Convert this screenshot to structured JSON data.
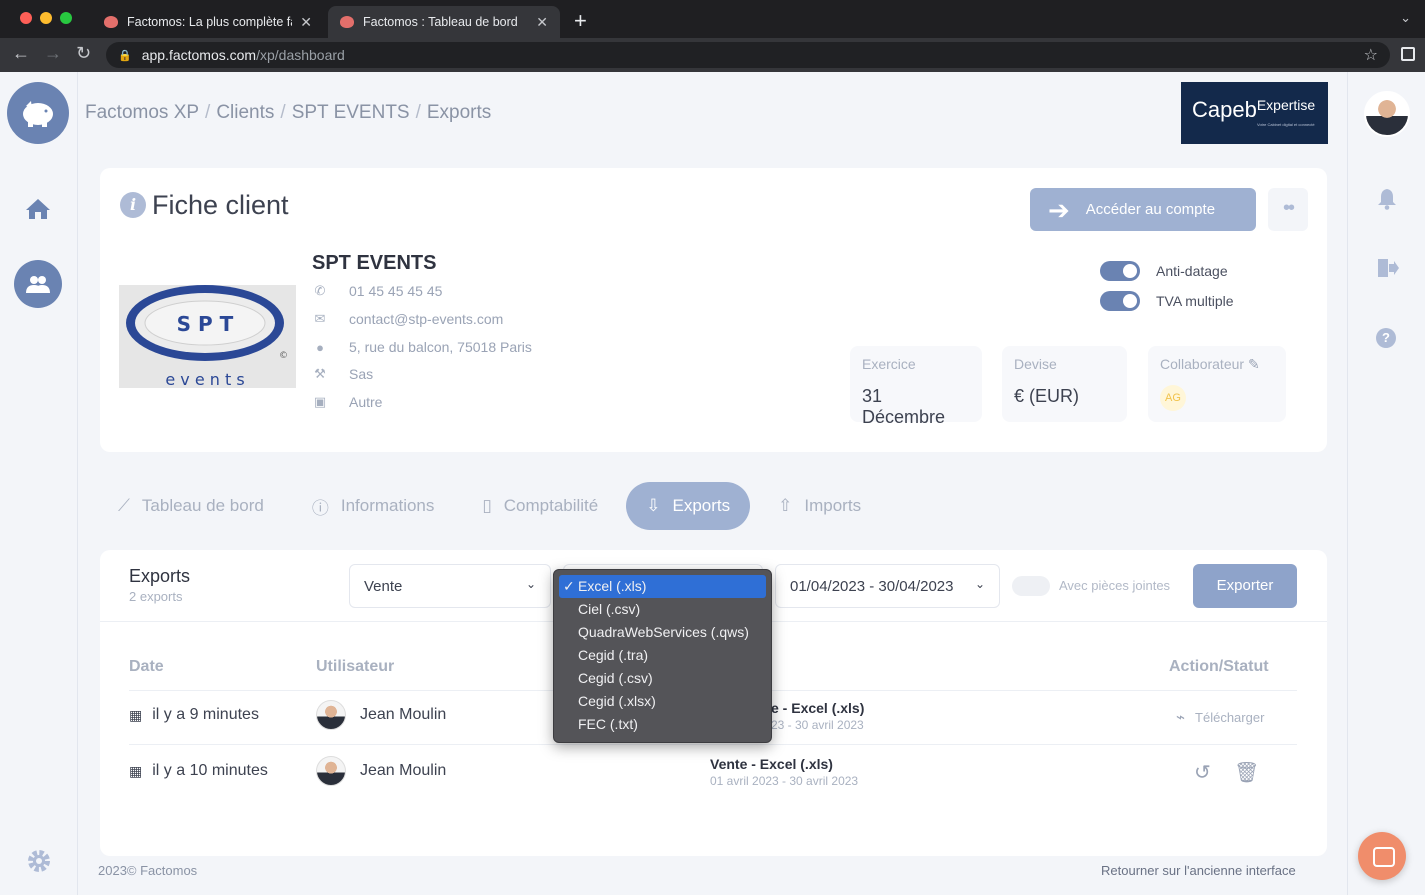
{
  "browser": {
    "tabs": [
      {
        "title": "Factomos: La plus complète fa",
        "active": false
      },
      {
        "title": "Factomos : Tableau de bord",
        "active": true
      }
    ],
    "url_host": "app.factomos.com",
    "url_path": "/xp/dashboard"
  },
  "breadcrumb": [
    "Factomos XP",
    "Clients",
    "SPT EVENTS",
    "Exports"
  ],
  "brand": {
    "name": "Capeb",
    "suffix": "Expertise",
    "tagline": "Votre Cabinet digital et connecté"
  },
  "fiche": {
    "title": "Fiche client",
    "access_button": "Accéder au compte",
    "client": {
      "name": "SPT EVENTS",
      "logo_letters_top": "S P T",
      "logo_letters_bottom": "e v e n t s",
      "phone": "01 45 45 45 45",
      "email": "contact@stp-events.com",
      "address": "5, rue du balcon, 75018 Paris",
      "legal_form": "Sas",
      "activity": "Autre"
    },
    "toggles": [
      {
        "label": "Anti-datage",
        "on": true
      },
      {
        "label": "TVA multiple",
        "on": true
      }
    ],
    "stats": {
      "exercice_label": "Exercice",
      "exercice_value": "31 Décembre",
      "devise_label": "Devise",
      "devise_value": "€ (EUR)",
      "collaborateur_label": "Collaborateur",
      "collaborateur_value": "AG"
    }
  },
  "tabs": [
    {
      "label": "Tableau de bord",
      "icon": "chart-line-icon",
      "active": false
    },
    {
      "label": "Informations",
      "icon": "info-icon",
      "active": false
    },
    {
      "label": "Comptabilité",
      "icon": "clipboard-icon",
      "active": false
    },
    {
      "label": "Exports",
      "icon": "export-icon",
      "active": true
    },
    {
      "label": "Imports",
      "icon": "import-icon",
      "active": false
    }
  ],
  "exports": {
    "title": "Exports",
    "count": "2 exports",
    "type_select": "Vente",
    "period_select": "01/04/2023 - 30/04/2023",
    "attachments_label": "Avec pièces jointes",
    "export_button": "Exporter",
    "format_options": [
      "Excel (.xls)",
      "Ciel (.csv)",
      "QuadraWebServices (.qws)",
      "Cegid (.tra)",
      "Cegid (.csv)",
      "Cegid (.xlsx)",
      "FEC (.txt)"
    ],
    "format_selected": "Excel (.xls)",
    "columns": {
      "date": "Date",
      "user": "Utilisateur",
      "action": "Action/Statut"
    },
    "rows": [
      {
        "date": "il y a 9 minutes",
        "user": "Jean Moulin",
        "type": "Vente - Excel (.xls)",
        "type_visible": "e - Excel (.xls)",
        "range": "01 avril 2023 - 30 avril 2023",
        "range_visible": "23 - 30 avril 2023",
        "action": "Télécharger"
      },
      {
        "date": "il y a 10 minutes",
        "user": "Jean Moulin",
        "type": "Vente - Excel (.xls)",
        "range": "01 avril 2023 - 30 avril 2023",
        "action": ""
      }
    ]
  },
  "footer": {
    "copyright": "2023© Factomos",
    "legacy_link": "Retourner sur l'ancienne interface"
  }
}
